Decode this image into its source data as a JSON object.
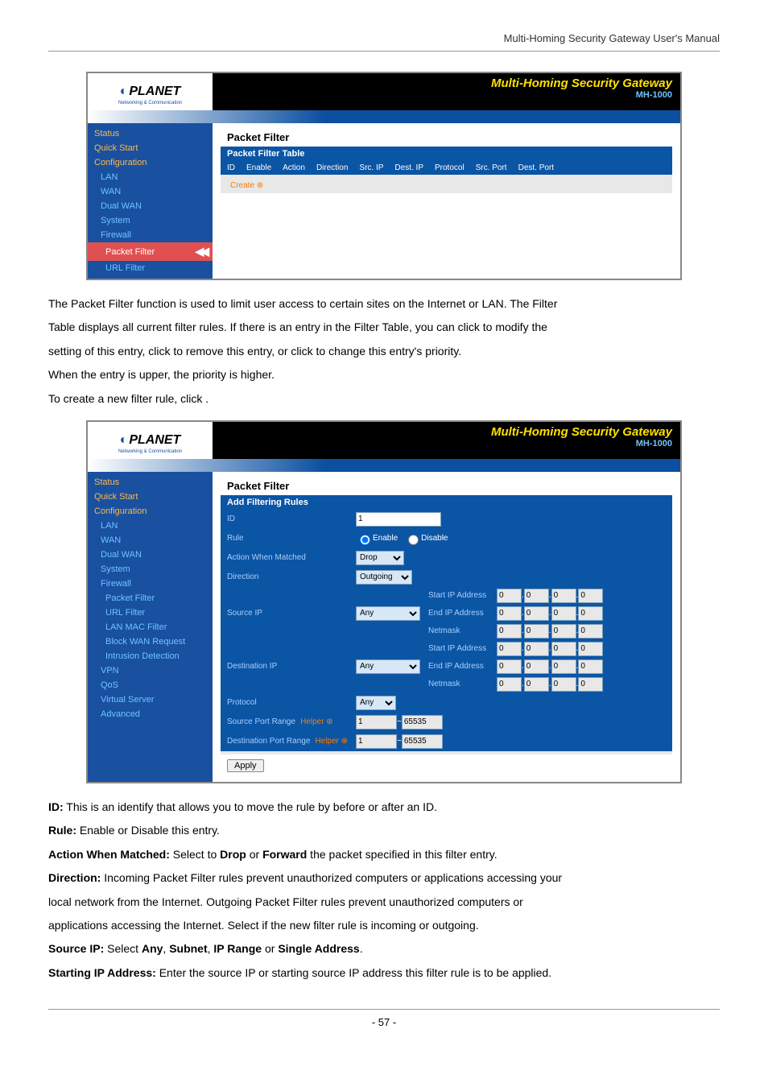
{
  "doc": {
    "header": "Multi-Homing Security Gateway User's Manual",
    "footer": "- 57 -"
  },
  "brand": {
    "name": "PLANET",
    "tagline": "Networking & Communication",
    "title": "Multi-Homing Security Gateway",
    "model": "MH-1000"
  },
  "screenshot1": {
    "sidebar": {
      "status": "Status",
      "quickstart": "Quick Start",
      "configuration": "Configuration",
      "lan": "LAN",
      "wan": "WAN",
      "dualwan": "Dual WAN",
      "system": "System",
      "firewall": "Firewall",
      "packetfilter": "Packet Filter",
      "urlfilter": "URL Filter"
    },
    "panel": {
      "title": "Packet Filter",
      "subtitle": "Packet Filter Table",
      "cols": {
        "id": "ID",
        "enable": "Enable",
        "action": "Action",
        "direction": "Direction",
        "srcip": "Src. IP",
        "destip": "Dest. IP",
        "protocol": "Protocol",
        "srcport": "Src. Port",
        "destport": "Dest. Port"
      },
      "create": "Create"
    }
  },
  "paragraph1": {
    "l1a": "The Packet Filter function is used to limit user access to certain sites on the Internet or LAN. The Filter",
    "l2a": "Table displays all current filter rules. If there is an entry in the Filter Table, you can click ",
    "l2b": " to modify the",
    "l3a": "setting of this entry, click ",
    "l3b": " to remove this entry, or click ",
    "l3c": " to change this entry's priority.",
    "l4a": "When the entry is upper, the priority is higher.",
    "l5a": "To create a new filter rule, click ",
    "l5b": "."
  },
  "screenshot2": {
    "sidebar": {
      "status": "Status",
      "quickstart": "Quick Start",
      "configuration": "Configuration",
      "lan": "LAN",
      "wan": "WAN",
      "dualwan": "Dual WAN",
      "system": "System",
      "firewall": "Firewall",
      "packetfilter": "Packet Filter",
      "urlfilter": "URL Filter",
      "lanmac": "LAN MAC Filter",
      "blockwan": "Block WAN Request",
      "intrusion": "Intrusion Detection",
      "vpn": "VPN",
      "qos": "QoS",
      "vserver": "Virtual Server",
      "advanced": "Advanced"
    },
    "form": {
      "title": "Packet Filter",
      "subtitle": "Add Filtering Rules",
      "id_label": "ID",
      "id_value": "1",
      "rule_label": "Rule",
      "rule_enable": "Enable",
      "rule_disable": "Disable",
      "action_label": "Action When Matched",
      "action_value": "Drop",
      "direction_label": "Direction",
      "direction_value": "Outgoing",
      "srcip_label": "Source IP",
      "srcip_select": "Any",
      "destip_label": "Destination IP",
      "destip_select": "Any",
      "startip": "Start IP Address",
      "endip": "End IP Address",
      "netmask": "Netmask",
      "ipzero": "0",
      "protocol_label": "Protocol",
      "protocol_value": "Any",
      "srcport_label": "Source Port Range",
      "destport_label": "Destination Port Range",
      "helper": "Helper",
      "port_from": "1",
      "port_to": "65535",
      "apply": "Apply"
    }
  },
  "paragraph2": {
    "id_a": "ID:",
    "id_b": " This is an identify that allows you to move the rule by before or after an ID.",
    "rule_a": "Rule:",
    "rule_b": " Enable or Disable this entry.",
    "action_a": "Action When Matched:",
    "action_b": " Select to ",
    "action_drop": "Drop",
    "action_c": " or ",
    "action_fwd": "Forward",
    "action_d": " the packet specified in this filter entry.",
    "dir_a": "Direction:",
    "dir_b": " Incoming Packet Filter rules prevent unauthorized computers or applications accessing your",
    "dir_c": "local network from the Internet. Outgoing Packet Filter rules prevent unauthorized computers or",
    "dir_d": "applications accessing the Internet. Select if the new filter rule is incoming or outgoing.",
    "src_a": "Source IP:",
    "src_b": " Select ",
    "src_any": "Any",
    "src_c": ", ",
    "src_subnet": "Subnet",
    "src_d": ", ",
    "src_range": "IP Range",
    "src_e": " or ",
    "src_single": "Single Address",
    "src_f": ".",
    "start_a": "Starting IP Address:",
    "start_b": " Enter the source IP or starting source IP address this filter rule is to be applied."
  }
}
